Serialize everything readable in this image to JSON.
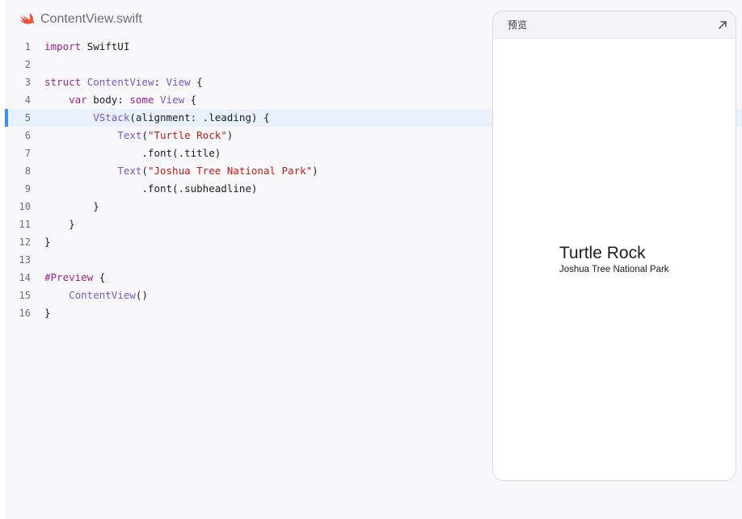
{
  "file": {
    "name": "ContentView.swift",
    "icon": "swift-logo-icon",
    "icon_color": "#f05138"
  },
  "editor": {
    "current_line": 5,
    "lines": [
      {
        "n": "1",
        "t": [
          {
            "s": "import",
            "c": "kw"
          },
          {
            "s": " SwiftUI",
            "c": ""
          }
        ]
      },
      {
        "n": "2",
        "t": []
      },
      {
        "n": "3",
        "t": [
          {
            "s": "struct",
            "c": "kw"
          },
          {
            "s": " ",
            "c": ""
          },
          {
            "s": "ContentView",
            "c": "ty"
          },
          {
            "s": ": ",
            "c": ""
          },
          {
            "s": "View",
            "c": "ty"
          },
          {
            "s": " {",
            "c": ""
          }
        ]
      },
      {
        "n": "4",
        "t": [
          {
            "s": "    ",
            "c": ""
          },
          {
            "s": "var",
            "c": "kw"
          },
          {
            "s": " body: ",
            "c": ""
          },
          {
            "s": "some",
            "c": "kw"
          },
          {
            "s": " ",
            "c": ""
          },
          {
            "s": "View",
            "c": "ty"
          },
          {
            "s": " {",
            "c": ""
          }
        ]
      },
      {
        "n": "5",
        "t": [
          {
            "s": "        ",
            "c": ""
          },
          {
            "s": "VStack",
            "c": "fn"
          },
          {
            "s": "(alignment: .leading) {",
            "c": ""
          }
        ]
      },
      {
        "n": "6",
        "t": [
          {
            "s": "            ",
            "c": ""
          },
          {
            "s": "Text",
            "c": "fn"
          },
          {
            "s": "(",
            "c": ""
          },
          {
            "s": "\"Turtle Rock\"",
            "c": "str"
          },
          {
            "s": ")",
            "c": ""
          }
        ]
      },
      {
        "n": "7",
        "t": [
          {
            "s": "                .font(.title)",
            "c": ""
          }
        ]
      },
      {
        "n": "8",
        "t": [
          {
            "s": "            ",
            "c": ""
          },
          {
            "s": "Text",
            "c": "fn"
          },
          {
            "s": "(",
            "c": ""
          },
          {
            "s": "\"Joshua Tree National Park\"",
            "c": "str"
          },
          {
            "s": ")",
            "c": ""
          }
        ]
      },
      {
        "n": "9",
        "t": [
          {
            "s": "                .font(.subheadline)",
            "c": ""
          }
        ]
      },
      {
        "n": "10",
        "t": [
          {
            "s": "        }",
            "c": ""
          }
        ]
      },
      {
        "n": "11",
        "t": [
          {
            "s": "    }",
            "c": ""
          }
        ]
      },
      {
        "n": "12",
        "t": [
          {
            "s": "}",
            "c": ""
          }
        ]
      },
      {
        "n": "13",
        "t": []
      },
      {
        "n": "14",
        "t": [
          {
            "s": "#Preview",
            "c": "kw"
          },
          {
            "s": " {",
            "c": ""
          }
        ]
      },
      {
        "n": "15",
        "t": [
          {
            "s": "    ",
            "c": ""
          },
          {
            "s": "ContentView",
            "c": "fn"
          },
          {
            "s": "()",
            "c": ""
          }
        ]
      },
      {
        "n": "16",
        "t": [
          {
            "s": "}",
            "c": ""
          }
        ]
      }
    ]
  },
  "preview": {
    "title": "预览",
    "expand_icon": "expand-arrow-icon",
    "content": {
      "title": "Turtle Rock",
      "subtitle": "Joshua Tree National Park"
    }
  }
}
